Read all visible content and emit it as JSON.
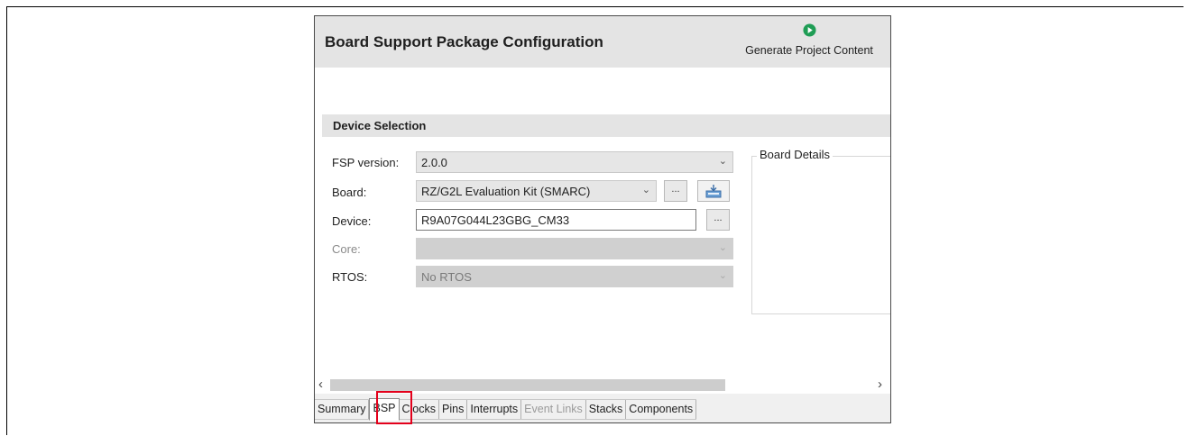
{
  "header": {
    "title": "Board Support Package Configuration",
    "generate_label": "Generate Project Content"
  },
  "device_selection": {
    "title": "Device Selection",
    "fsp_version": {
      "label": "FSP version:",
      "value": "2.0.0"
    },
    "board": {
      "label": "Board:",
      "value": "RZ/G2L Evaluation Kit (SMARC)",
      "browse_label": "..."
    },
    "device": {
      "label": "Device:",
      "value": "R9A07G044L23GBG_CM33",
      "browse_label": "..."
    },
    "core": {
      "label": "Core:",
      "value": ""
    },
    "rtos": {
      "label": "RTOS:",
      "value": "No RTOS"
    }
  },
  "board_details": {
    "label": "Board Details"
  },
  "tabs": [
    {
      "label": "Summary"
    },
    {
      "label": "BSP"
    },
    {
      "label": "Clocks"
    },
    {
      "label": "Pins"
    },
    {
      "label": "Interrupts"
    },
    {
      "label": "Event Links"
    },
    {
      "label": "Stacks"
    },
    {
      "label": "Components"
    }
  ],
  "colors": {
    "generate_icon": "#1f9d55",
    "highlight": "#e3001b",
    "header_bg": "#e4e4e4"
  },
  "icons": {
    "generate": "play-circle-icon",
    "import": "import-board-icon",
    "dropdown": "chevron-down-icon"
  }
}
